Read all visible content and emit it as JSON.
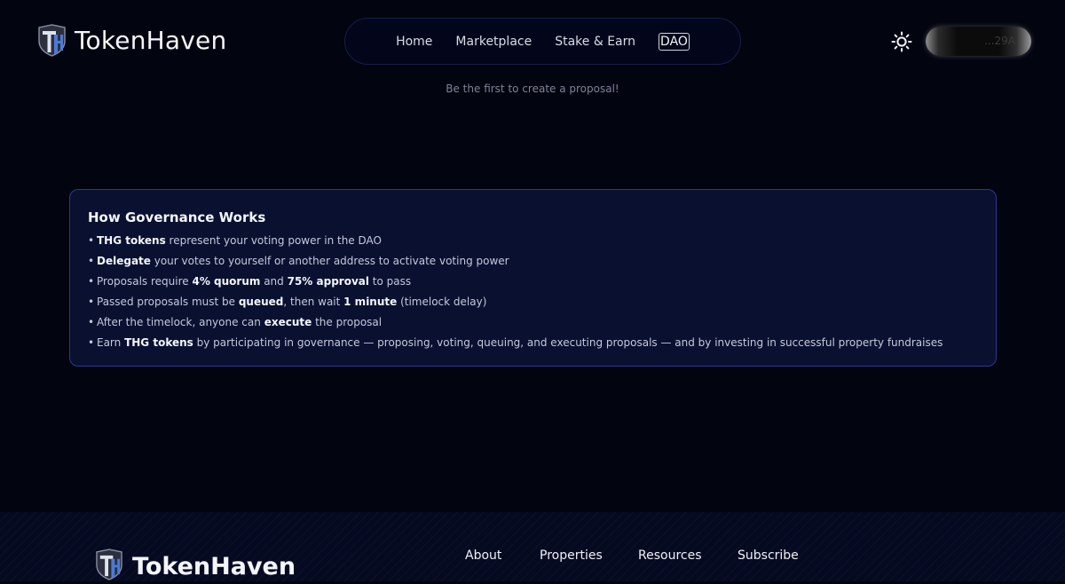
{
  "brand": {
    "name": "TokenHaven"
  },
  "nav": {
    "items": [
      {
        "label": "Home"
      },
      {
        "label": "Marketplace"
      },
      {
        "label": "Stake & Earn"
      },
      {
        "label": "DAO"
      }
    ],
    "active": "DAO"
  },
  "header": {
    "theme_icon": "sun-icon",
    "wallet_label": "...29A"
  },
  "proposals": {
    "empty_message": "Be the first to create a proposal!"
  },
  "governance": {
    "title": "How Governance Works",
    "items": [
      {
        "bold": "THG tokens",
        "rest": " represent your voting power in the DAO"
      },
      {
        "bold": "Delegate",
        "rest": " your votes to yourself or another address to activate voting power"
      },
      {
        "pre": "Proposals require ",
        "bold": "4% quorum",
        "mid": " and ",
        "bold2": "75% approval",
        "rest": " to pass"
      },
      {
        "pre": "Passed proposals must be ",
        "bold": "queued",
        "mid": ", then wait ",
        "bold2": "1 minute",
        "rest": " (timelock delay)"
      },
      {
        "pre": "After the timelock, anyone can ",
        "bold": "execute",
        "rest": " the proposal"
      },
      {
        "pre": "Earn ",
        "bold": "THG tokens",
        "rest": " by participating in governance — proposing, voting, queuing, and executing proposals — and by investing in successful property fundraises"
      }
    ]
  },
  "footer": {
    "brand_name": "TokenHaven",
    "links": [
      {
        "label": "About"
      },
      {
        "label": "Properties"
      },
      {
        "label": "Resources"
      },
      {
        "label": "Subscribe"
      }
    ]
  },
  "colors": {
    "background": "#02040f",
    "card_border": "#2a3a8c",
    "card_background": "#0a1030",
    "logo_accent": "#4a7bd8"
  }
}
